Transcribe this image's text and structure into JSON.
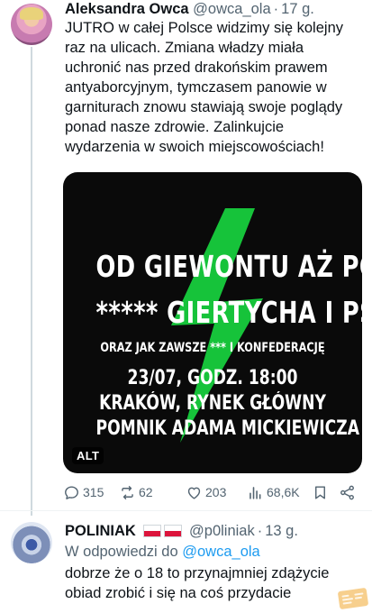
{
  "tweet_main": {
    "author_name": "Aleksandra Owca",
    "handle": "@owca_ola",
    "separator": "·",
    "time": "17 g.",
    "text": "JUTRO w całej Polsce widzimy się kolejny raz na ulicach. Zmiana władzy miała uchronić nas przed drakońskim prawem antyaborcyjnym, tymczasem panowie w garniturach znowu stawiają swoje poglądy ponad nasze zdrowie. Zalinkujcie wydarzenia w swoich miejscowościach!",
    "media": {
      "line1": "OD GIEWONTU AŻ PO HEL",
      "line2": "***** GIERTYCHA I PSL",
      "line3": "ORAZ JAK ZAWSZE *** I KONFEDERACJĘ",
      "line4": "23/07, GODZ. 18:00",
      "line5": "KRAKÓW, RYNEK GŁÓWNY",
      "line6": "POMNIK ADAMA MICKIEWICZA",
      "alt_label": "ALT",
      "bolt_color": "#16c33a"
    },
    "actions": {
      "replies": "315",
      "retweets": "62",
      "likes": "203",
      "views": "68,6K"
    }
  },
  "tweet_reply": {
    "author_name": "POLINIAK",
    "handle": "@p0liniak",
    "separator": "·",
    "time": "13 g.",
    "reply_prefix": "W odpowiedzi do",
    "reply_mention": "@owca_ola",
    "text": "dobrze że o 18 to przynajmniej zdążycie obiad zrobić i się na coś przydacie"
  },
  "icons": {
    "reply": "reply-icon",
    "retweet": "retweet-icon",
    "like": "heart-icon",
    "views": "views-icon",
    "bookmark": "bookmark-icon",
    "share": "share-icon",
    "flag": "poland-flag-icon"
  },
  "colors": {
    "text": "#0f1419",
    "secondary": "#536471",
    "link": "#1d9bf0",
    "media_bg": "#0a0a0a"
  }
}
